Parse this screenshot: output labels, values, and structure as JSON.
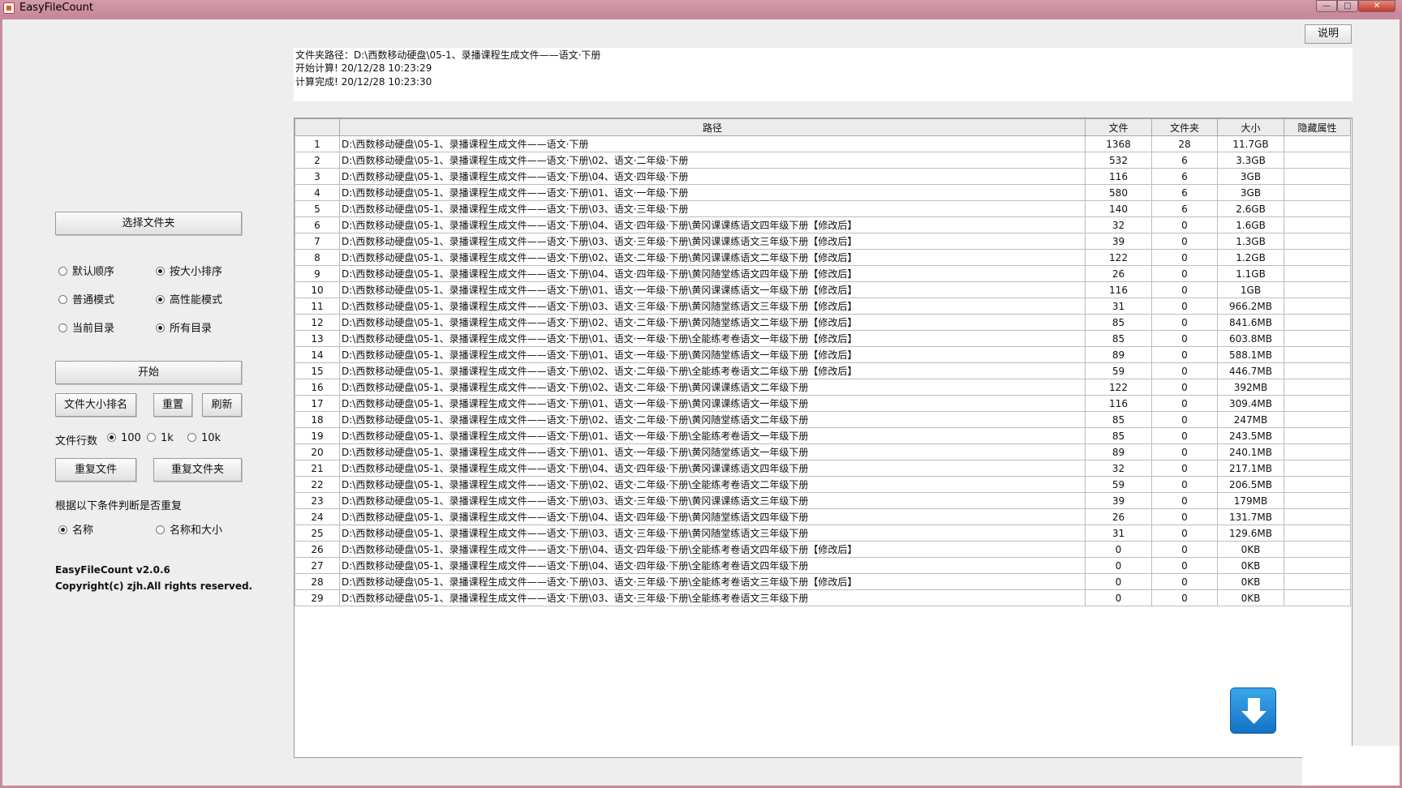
{
  "window": {
    "title": "EasyFileCount",
    "min_label": "—",
    "max_label": "□",
    "close_label": "✕"
  },
  "toolbar": {
    "help_label": "说明"
  },
  "info": {
    "line1": "文件夹路径：D:\\西数移动硬盘\\05-1、录播课程生成文件——语文·下册",
    "line2": "开始计算! 20/12/28 10:23:29",
    "line3": "计算完成! 20/12/28 10:23:30"
  },
  "table": {
    "columns": [
      "",
      "路径",
      "文件",
      "文件夹",
      "大小",
      "隐藏属性"
    ],
    "rows": [
      [
        "1",
        "D:\\西数移动硬盘\\05-1、录播课程生成文件——语文·下册",
        "1368",
        "28",
        "11.7GB",
        ""
      ],
      [
        "2",
        "D:\\西数移动硬盘\\05-1、录播课程生成文件——语文·下册\\02、语文·二年级·下册",
        "532",
        "6",
        "3.3GB",
        ""
      ],
      [
        "3",
        "D:\\西数移动硬盘\\05-1、录播课程生成文件——语文·下册\\04、语文·四年级·下册",
        "116",
        "6",
        "3GB",
        ""
      ],
      [
        "4",
        "D:\\西数移动硬盘\\05-1、录播课程生成文件——语文·下册\\01、语文·一年级·下册",
        "580",
        "6",
        "3GB",
        ""
      ],
      [
        "5",
        "D:\\西数移动硬盘\\05-1、录播课程生成文件——语文·下册\\03、语文·三年级·下册",
        "140",
        "6",
        "2.6GB",
        ""
      ],
      [
        "6",
        "D:\\西数移动硬盘\\05-1、录播课程生成文件——语文·下册\\04、语文·四年级·下册\\黄冈课课练语文四年级下册【修改后】",
        "32",
        "0",
        "1.6GB",
        ""
      ],
      [
        "7",
        "D:\\西数移动硬盘\\05-1、录播课程生成文件——语文·下册\\03、语文·三年级·下册\\黄冈课课练语文三年级下册【修改后】",
        "39",
        "0",
        "1.3GB",
        ""
      ],
      [
        "8",
        "D:\\西数移动硬盘\\05-1、录播课程生成文件——语文·下册\\02、语文·二年级·下册\\黄冈课课练语文二年级下册【修改后】",
        "122",
        "0",
        "1.2GB",
        ""
      ],
      [
        "9",
        "D:\\西数移动硬盘\\05-1、录播课程生成文件——语文·下册\\04、语文·四年级·下册\\黄冈随堂练语文四年级下册【修改后】",
        "26",
        "0",
        "1.1GB",
        ""
      ],
      [
        "10",
        "D:\\西数移动硬盘\\05-1、录播课程生成文件——语文·下册\\01、语文·一年级·下册\\黄冈课课练语文一年级下册【修改后】",
        "116",
        "0",
        "1GB",
        ""
      ],
      [
        "11",
        "D:\\西数移动硬盘\\05-1、录播课程生成文件——语文·下册\\03、语文·三年级·下册\\黄冈随堂练语文三年级下册【修改后】",
        "31",
        "0",
        "966.2MB",
        ""
      ],
      [
        "12",
        "D:\\西数移动硬盘\\05-1、录播课程生成文件——语文·下册\\02、语文·二年级·下册\\黄冈随堂练语文二年级下册【修改后】",
        "85",
        "0",
        "841.6MB",
        ""
      ],
      [
        "13",
        "D:\\西数移动硬盘\\05-1、录播课程生成文件——语文·下册\\01、语文·一年级·下册\\全能练考卷语文一年级下册【修改后】",
        "85",
        "0",
        "603.8MB",
        ""
      ],
      [
        "14",
        "D:\\西数移动硬盘\\05-1、录播课程生成文件——语文·下册\\01、语文·一年级·下册\\黄冈随堂练语文一年级下册【修改后】",
        "89",
        "0",
        "588.1MB",
        ""
      ],
      [
        "15",
        "D:\\西数移动硬盘\\05-1、录播课程生成文件——语文·下册\\02、语文·二年级·下册\\全能练考卷语文二年级下册【修改后】",
        "59",
        "0",
        "446.7MB",
        ""
      ],
      [
        "16",
        "D:\\西数移动硬盘\\05-1、录播课程生成文件——语文·下册\\02、语文·二年级·下册\\黄冈课课练语文二年级下册",
        "122",
        "0",
        "392MB",
        ""
      ],
      [
        "17",
        "D:\\西数移动硬盘\\05-1、录播课程生成文件——语文·下册\\01、语文·一年级·下册\\黄冈课课练语文一年级下册",
        "116",
        "0",
        "309.4MB",
        ""
      ],
      [
        "18",
        "D:\\西数移动硬盘\\05-1、录播课程生成文件——语文·下册\\02、语文·二年级·下册\\黄冈随堂练语文二年级下册",
        "85",
        "0",
        "247MB",
        ""
      ],
      [
        "19",
        "D:\\西数移动硬盘\\05-1、录播课程生成文件——语文·下册\\01、语文·一年级·下册\\全能练考卷语文一年级下册",
        "85",
        "0",
        "243.5MB",
        ""
      ],
      [
        "20",
        "D:\\西数移动硬盘\\05-1、录播课程生成文件——语文·下册\\01、语文·一年级·下册\\黄冈随堂练语文一年级下册",
        "89",
        "0",
        "240.1MB",
        ""
      ],
      [
        "21",
        "D:\\西数移动硬盘\\05-1、录播课程生成文件——语文·下册\\04、语文·四年级·下册\\黄冈课课练语文四年级下册",
        "32",
        "0",
        "217.1MB",
        ""
      ],
      [
        "22",
        "D:\\西数移动硬盘\\05-1、录播课程生成文件——语文·下册\\02、语文·二年级·下册\\全能练考卷语文二年级下册",
        "59",
        "0",
        "206.5MB",
        ""
      ],
      [
        "23",
        "D:\\西数移动硬盘\\05-1、录播课程生成文件——语文·下册\\03、语文·三年级·下册\\黄冈课课练语文三年级下册",
        "39",
        "0",
        "179MB",
        ""
      ],
      [
        "24",
        "D:\\西数移动硬盘\\05-1、录播课程生成文件——语文·下册\\04、语文·四年级·下册\\黄冈随堂练语文四年级下册",
        "26",
        "0",
        "131.7MB",
        ""
      ],
      [
        "25",
        "D:\\西数移动硬盘\\05-1、录播课程生成文件——语文·下册\\03、语文·三年级·下册\\黄冈随堂练语文三年级下册",
        "31",
        "0",
        "129.6MB",
        ""
      ],
      [
        "26",
        "D:\\西数移动硬盘\\05-1、录播课程生成文件——语文·下册\\04、语文·四年级·下册\\全能练考卷语文四年级下册【修改后】",
        "0",
        "0",
        "0KB",
        ""
      ],
      [
        "27",
        "D:\\西数移动硬盘\\05-1、录播课程生成文件——语文·下册\\04、语文·四年级·下册\\全能练考卷语文四年级下册",
        "0",
        "0",
        "0KB",
        ""
      ],
      [
        "28",
        "D:\\西数移动硬盘\\05-1、录播课程生成文件——语文·下册\\03、语文·三年级·下册\\全能练考卷语文三年级下册【修改后】",
        "0",
        "0",
        "0KB",
        ""
      ],
      [
        "29",
        "D:\\西数移动硬盘\\05-1、录播课程生成文件——语文·下册\\03、语文·三年级·下册\\全能练考卷语文三年级下册",
        "0",
        "0",
        "0KB",
        ""
      ]
    ]
  },
  "sidebar": {
    "select_folder": "选择文件夹",
    "sort_default": "默认顺序",
    "sort_size": "按大小排序",
    "mode_normal": "普通模式",
    "mode_high": "高性能模式",
    "dir_current": "当前目录",
    "dir_all": "所有目录",
    "start": "开始",
    "rank_size": "文件大小排名",
    "reset": "重置",
    "refresh": "刷新",
    "file_rows_label": "文件行数",
    "rows_100": "100",
    "rows_1k": "1k",
    "rows_10k": "10k",
    "dup_files": "重复文件",
    "dup_folders": "重复文件夹",
    "dup_criteria": "根据以下条件判断是否重复",
    "crit_name": "名称",
    "crit_name_size": "名称和大小",
    "version": "EasyFileCount v2.0.6",
    "copyright": "Copyright(c) zjh.All rights reserved."
  },
  "selected": {
    "sort": "size",
    "mode": "high",
    "dir": "all",
    "rows": "100",
    "criteria": "name"
  },
  "icons": {
    "download": "arrow-down-icon",
    "app": "app-icon"
  }
}
